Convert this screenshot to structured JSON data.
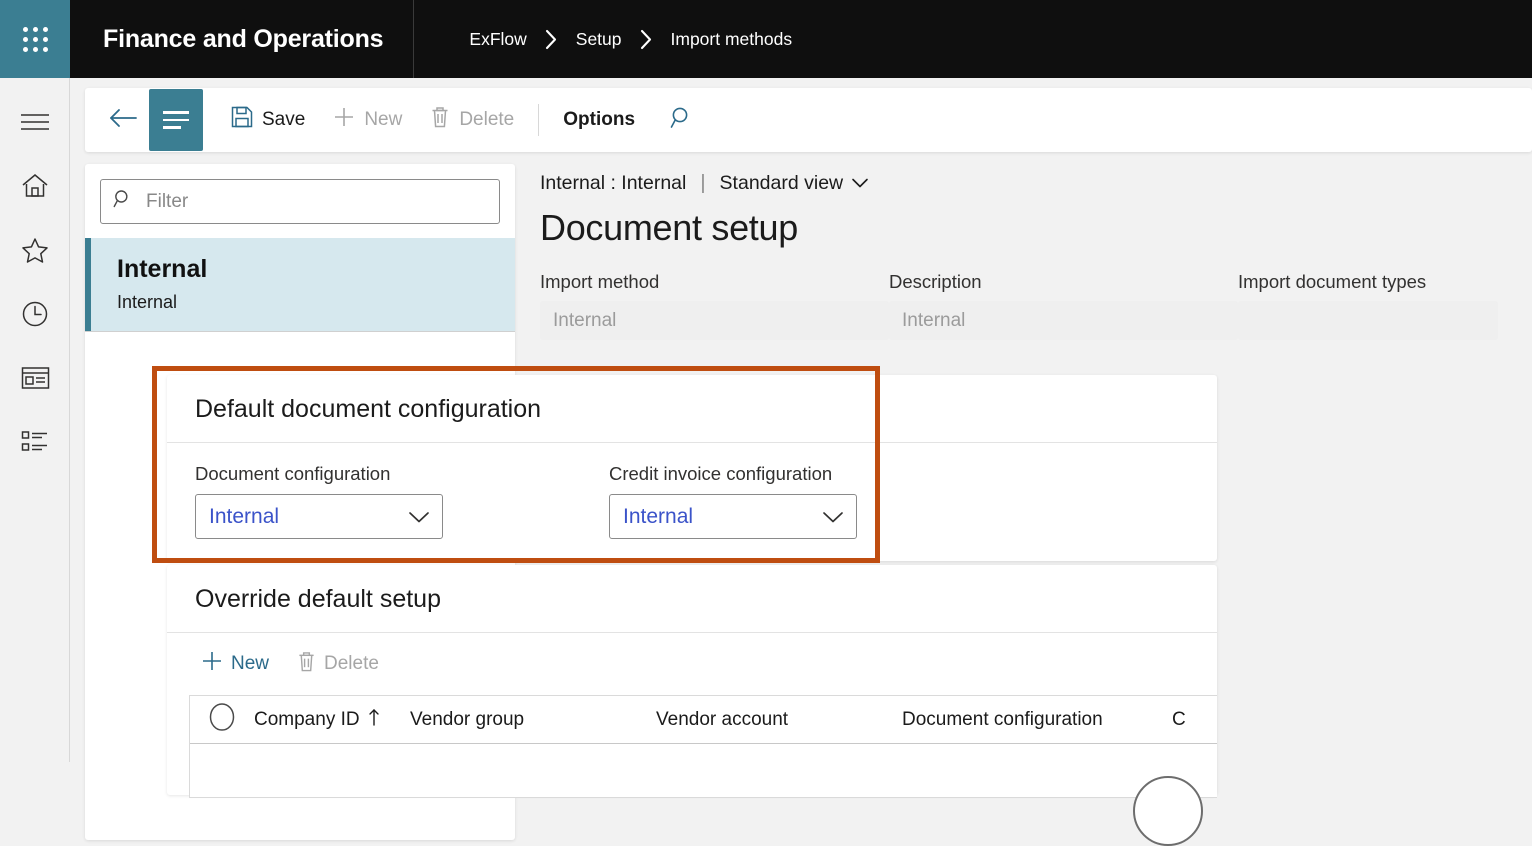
{
  "topbar": {
    "waffle_icon": "app-launcher-icon",
    "app_title": "Finance and Operations",
    "breadcrumb": [
      {
        "label": "ExFlow"
      },
      {
        "label": "Setup"
      },
      {
        "label": "Import methods"
      }
    ]
  },
  "rail": {
    "items": [
      {
        "icon": "hamburger-menu-icon",
        "name": "nav-menu"
      },
      {
        "icon": "home-icon",
        "name": "home"
      },
      {
        "icon": "star-icon",
        "name": "favorites"
      },
      {
        "icon": "clock-icon",
        "name": "recent"
      },
      {
        "icon": "workspace-icon",
        "name": "workspaces"
      },
      {
        "icon": "modules-list-icon",
        "name": "modules"
      }
    ]
  },
  "commandbar": {
    "back_icon": "back-arrow-icon",
    "toggle_icon": "nav-pane-toggle-icon",
    "save_label": "Save",
    "save_icon": "save-floppy-icon",
    "new_label": "New",
    "new_icon": "plus-icon",
    "delete_label": "Delete",
    "delete_icon": "trash-icon",
    "options_label": "Options",
    "search_icon": "search-icon"
  },
  "listpane": {
    "filter_placeholder": "Filter",
    "filter_value": "",
    "filter_icon": "search-icon",
    "items": [
      {
        "title": "Internal",
        "subtitle": "Internal",
        "selected": true
      }
    ]
  },
  "detail": {
    "caption": "Internal : Internal",
    "divider": "|",
    "view_label": "Standard view",
    "view_chevron": "chevron-down-icon",
    "page_title": "Document setup",
    "fields": [
      {
        "label": "Import method",
        "value": "Internal"
      },
      {
        "label": "Description",
        "value": "Internal"
      },
      {
        "label": "Import document types",
        "value": ""
      }
    ]
  },
  "default_config": {
    "header": "Default document configuration",
    "highlight_color": "#bf4d10",
    "combos": [
      {
        "label": "Document configuration",
        "value": "Internal",
        "chevron": "chevron-down-icon"
      },
      {
        "label": "Credit invoice configuration",
        "value": "Internal",
        "chevron": "chevron-down-icon"
      }
    ]
  },
  "override": {
    "header": "Override default setup",
    "toolbar": {
      "new_label": "New",
      "new_icon": "plus-icon",
      "delete_label": "Delete",
      "delete_icon": "trash-icon"
    },
    "grid": {
      "select_all_icon": "row-select-circle-icon",
      "columns": [
        {
          "label": "Company ID",
          "sort_icon": "sort-ascending-arrow-icon"
        },
        {
          "label": "Vendor group"
        },
        {
          "label": "Vendor account"
        },
        {
          "label": "Document configuration"
        },
        {
          "label": "C"
        }
      ],
      "rows": [
        {
          "cells": [
            "",
            "",
            "",
            "",
            ""
          ]
        }
      ]
    }
  },
  "colors": {
    "accent_teal": "#3b7e92",
    "topbar_bg": "#0f0f0f",
    "link_blue": "#3b53c9",
    "highlight_orange": "#bf4d10",
    "selected_row_bg": "#d6e8ee"
  }
}
